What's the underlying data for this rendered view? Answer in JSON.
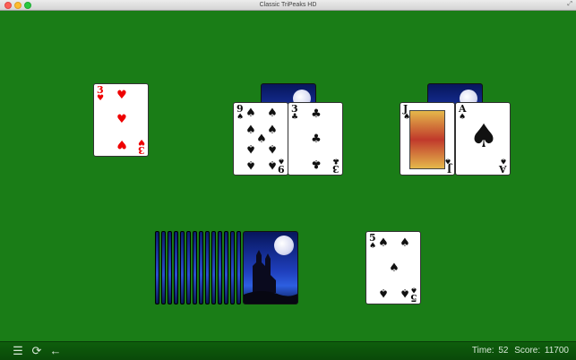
{
  "window": {
    "title": "Classic TriPeaks HD"
  },
  "cards": {
    "three_hearts": {
      "rank": "3",
      "suit": "♥"
    },
    "nine_spades": {
      "rank": "9",
      "suit": "♠"
    },
    "three_clubs": {
      "rank": "3",
      "suit": "♣"
    },
    "jack_spades": {
      "rank": "J",
      "suit": "♠"
    },
    "ace_spades": {
      "rank": "A",
      "suit": "♠"
    },
    "five_spades": {
      "rank": "5",
      "suit": "♠"
    }
  },
  "stock": {
    "count": 14
  },
  "status": {
    "time_label": "Time:",
    "time_value": "52",
    "score_label": "Score:",
    "score_value": "11700"
  },
  "toolbar": {
    "menu_icon": "menu-icon",
    "restart_icon": "restart-icon",
    "undo_icon": "undo-icon"
  },
  "colors": {
    "felt": "#1a7d17",
    "bar": "#0e5e0c",
    "red_suit": "#ee0000",
    "black_suit": "#111111"
  }
}
